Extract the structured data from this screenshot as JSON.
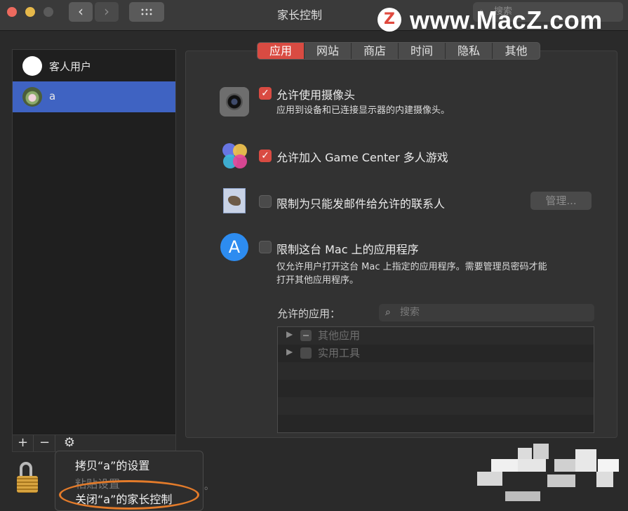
{
  "window": {
    "title": "家长控制",
    "search_placeholder": "搜索"
  },
  "watermark": {
    "logo_letter": "Z",
    "text": "www.MacZ.com"
  },
  "sidebar": {
    "users": [
      {
        "name": "客人用户",
        "selected": false
      },
      {
        "name": "a",
        "selected": true
      }
    ],
    "tools": {
      "add": "+",
      "remove": "−",
      "gear": "⚙"
    }
  },
  "context_menu": {
    "items": [
      {
        "label": "拷贝“a”的设置",
        "enabled": true
      },
      {
        "label": "粘贴设置",
        "enabled": false
      },
      {
        "label": "关闭“a”的家长控制",
        "enabled": true,
        "highlighted": true
      }
    ]
  },
  "tabs": [
    {
      "label": "应用",
      "active": true
    },
    {
      "label": "网站",
      "active": false
    },
    {
      "label": "商店",
      "active": false
    },
    {
      "label": "时间",
      "active": false
    },
    {
      "label": "隐私",
      "active": false
    },
    {
      "label": "其他",
      "active": false
    }
  ],
  "settings": {
    "camera": {
      "label": "允许使用摄像头",
      "desc": "应用到设备和已连接显示器的内建摄像头。",
      "checked": true
    },
    "game_center": {
      "label": "允许加入 Game Center 多人游戏",
      "checked": true
    },
    "mail": {
      "label": "限制为只能发邮件给允许的联系人",
      "checked": false,
      "manage_button": "管理..."
    },
    "apps": {
      "label": "限制这台 Mac 上的应用程序",
      "checked": false,
      "desc_line1": "仅允许用户打开这台 Mac 上指定的应用程序。需要管理员密码才能",
      "desc_line2": "打开其他应用程序。"
    }
  },
  "allowed_apps": {
    "label": "允许的应用：",
    "search_placeholder": "搜索",
    "items": [
      {
        "label": "其他应用"
      },
      {
        "label": "实用工具"
      }
    ]
  },
  "colors": {
    "accent": "#d94b42",
    "selection": "#3f63c2",
    "highlight_oval": "#e37b2a"
  }
}
